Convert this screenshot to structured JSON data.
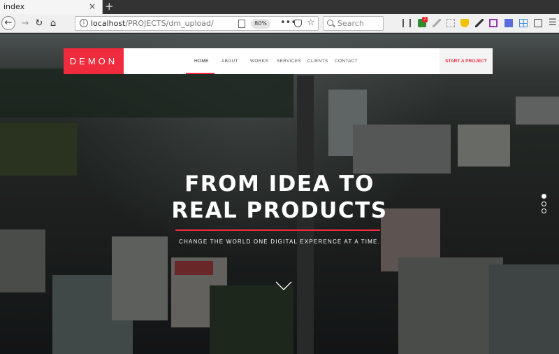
{
  "browser": {
    "tab_title": "index",
    "tab_close": "×",
    "new_tab": "+",
    "url_host": "localhost",
    "url_path": "/PROJECTS/dm_upload/",
    "zoom": "80%",
    "search_placeholder": "Search",
    "extension_badge": "7"
  },
  "site": {
    "brand": "DEMON",
    "menu": [
      "HOME",
      "ABOUT",
      "WORKS",
      "SERVICES",
      "CLIENTS",
      "CONTACT"
    ],
    "active_menu": "HOME",
    "cta": "START A PROJECT"
  },
  "hero": {
    "title_line1": "FROM IDEA TO",
    "title_line2": "REAL PRODUCTS",
    "subtitle": "CHANGE THE WORLD ONE DIGITAL EXPERENCE AT A TIME.",
    "slides_total": 3,
    "slides_active": 1
  },
  "colors": {
    "accent": "#ef2b3d",
    "nav_bg": "#ffffff",
    "hero_text": "#ffffff"
  },
  "icons": [
    "back-icon",
    "forward-icon",
    "reload-icon",
    "home-icon",
    "info-icon",
    "reader-icon",
    "pocket-icon",
    "star-icon",
    "search-icon",
    "library-icon",
    "sidebar-icon",
    "menu-icon",
    "chevron-down-icon"
  ]
}
